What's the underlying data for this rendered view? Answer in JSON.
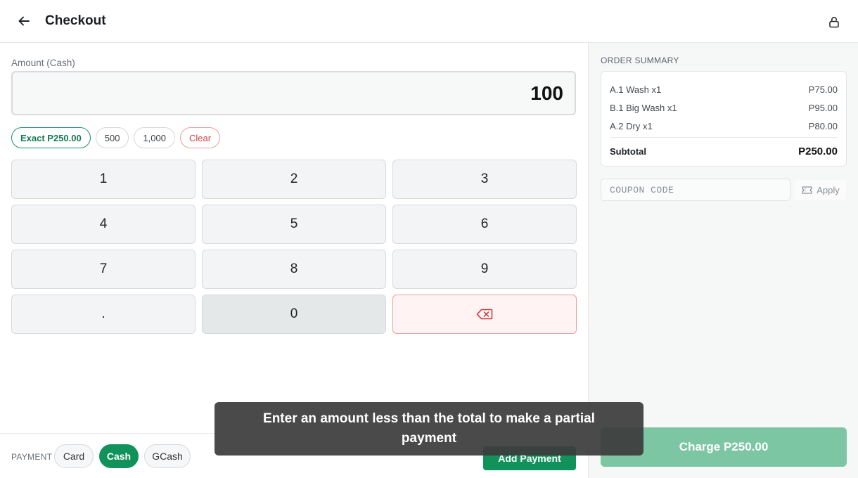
{
  "header": {
    "title": "Checkout",
    "back_icon": "arrow-left-icon",
    "lock_icon": "lock-open-icon"
  },
  "amount": {
    "label": "Amount (Cash)",
    "value": "100"
  },
  "quick_amounts": {
    "exact": "Exact P250.00",
    "options": [
      "500",
      "1,000"
    ],
    "clear": "Clear"
  },
  "keypad": {
    "keys": [
      "1",
      "2",
      "3",
      "4",
      "5",
      "6",
      "7",
      "8",
      "9",
      ".",
      "0"
    ],
    "delete_icon": "backspace-icon"
  },
  "payment": {
    "label": "PAYMENT",
    "methods": [
      "Card",
      "Cash",
      "GCash"
    ],
    "selected": "Cash",
    "add_payment": "Add Payment"
  },
  "summary": {
    "title": "ORDER SUMMARY",
    "items": [
      {
        "name": "A.1 Wash x1",
        "price": "P75.00"
      },
      {
        "name": "B.1 Big Wash x1",
        "price": "P95.00"
      },
      {
        "name": "A.2 Dry x1",
        "price": "P80.00"
      }
    ],
    "subtotal_label": "Subtotal",
    "subtotal_value": "P250.00"
  },
  "coupon": {
    "placeholder": "COUPON CODE",
    "value": "",
    "apply_label": "Apply",
    "apply_icon": "ticket-icon"
  },
  "charge": {
    "label": "Charge P250.00"
  },
  "toast": {
    "message": "Enter an amount less than the total to make a partial payment"
  },
  "colors": {
    "accent": "#11925b",
    "charge_disabled": "#7cc6a3",
    "danger": "#d14545"
  }
}
